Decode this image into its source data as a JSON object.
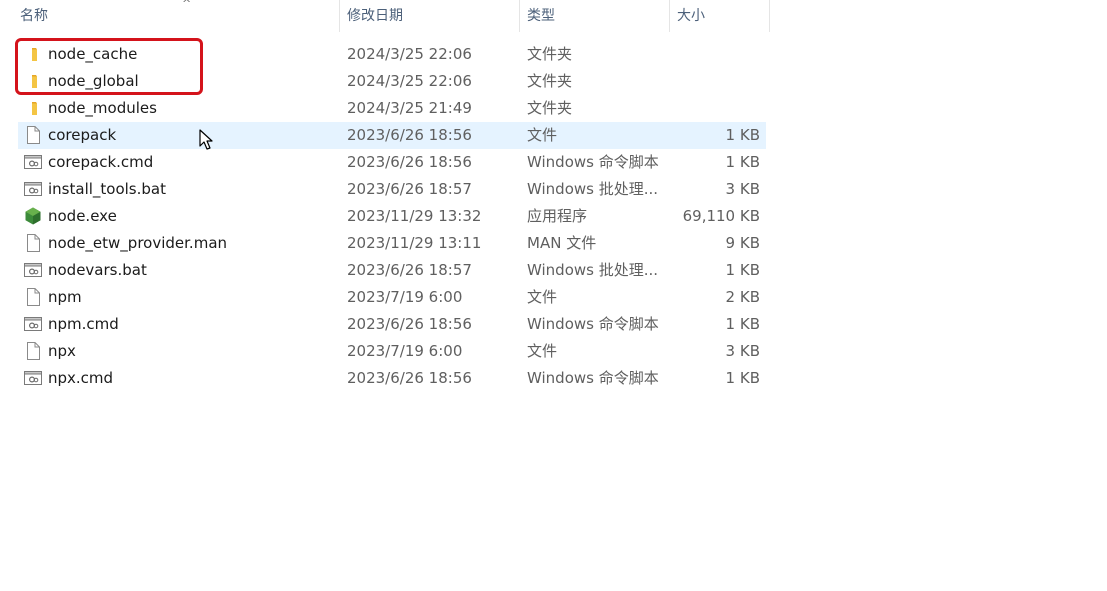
{
  "columns": {
    "name": "名称",
    "modified": "修改日期",
    "type": "类型",
    "size": "大小"
  },
  "files": [
    {
      "name": "node_cache",
      "modified": "2024/3/25 22:06",
      "type": "文件夹",
      "size": "",
      "icon": "folder-icon"
    },
    {
      "name": "node_global",
      "modified": "2024/3/25 22:06",
      "type": "文件夹",
      "size": "",
      "icon": "folder-icon"
    },
    {
      "name": "node_modules",
      "modified": "2024/3/25 21:49",
      "type": "文件夹",
      "size": "",
      "icon": "folder-icon"
    },
    {
      "name": "corepack",
      "modified": "2023/6/26 18:56",
      "type": "文件",
      "size": "1 KB",
      "icon": "file-icon"
    },
    {
      "name": "corepack.cmd",
      "modified": "2023/6/26 18:56",
      "type": "Windows 命令脚本",
      "size": "1 KB",
      "icon": "script-icon"
    },
    {
      "name": "install_tools.bat",
      "modified": "2023/6/26 18:57",
      "type": "Windows 批处理...",
      "size": "3 KB",
      "icon": "script-icon"
    },
    {
      "name": "node.exe",
      "modified": "2023/11/29 13:32",
      "type": "应用程序",
      "size": "69,110 KB",
      "icon": "nodejs-icon"
    },
    {
      "name": "node_etw_provider.man",
      "modified": "2023/11/29 13:11",
      "type": "MAN 文件",
      "size": "9 KB",
      "icon": "file-icon"
    },
    {
      "name": "nodevars.bat",
      "modified": "2023/6/26 18:57",
      "type": "Windows 批处理...",
      "size": "1 KB",
      "icon": "script-icon"
    },
    {
      "name": "npm",
      "modified": "2023/7/19 6:00",
      "type": "文件",
      "size": "2 KB",
      "icon": "file-icon"
    },
    {
      "name": "npm.cmd",
      "modified": "2023/6/26 18:56",
      "type": "Windows 命令脚本",
      "size": "1 KB",
      "icon": "script-icon"
    },
    {
      "name": "npx",
      "modified": "2023/7/19 6:00",
      "type": "文件",
      "size": "3 KB",
      "icon": "file-icon"
    },
    {
      "name": "npx.cmd",
      "modified": "2023/6/26 18:56",
      "type": "Windows 命令脚本",
      "size": "1 KB",
      "icon": "script-icon"
    }
  ],
  "hover_row_index": 3,
  "colors": {
    "highlight_border": "#d4131b",
    "hover_background": "#e5f3ff",
    "folder": "#f4c544",
    "node_icon": "#3c8a3a"
  }
}
